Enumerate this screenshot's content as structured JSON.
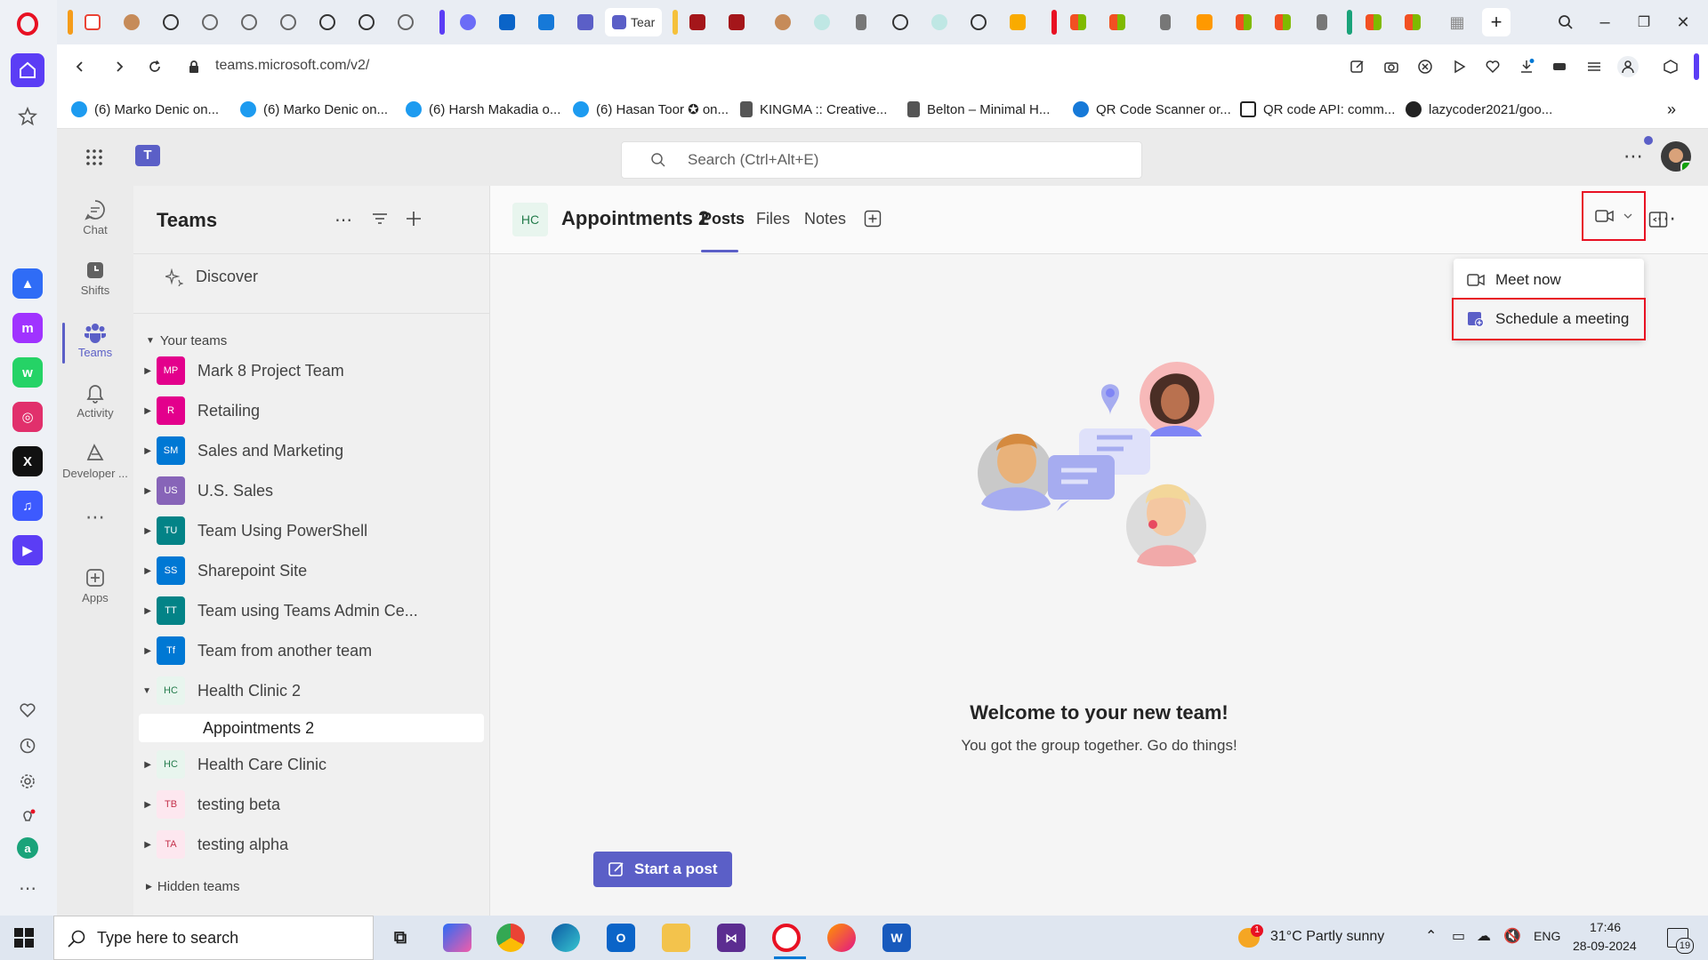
{
  "browser": {
    "url": "teams.microsoft.com/v2/",
    "active_tab_title": "Tear",
    "bookmarks": [
      "(6) Marko Denic on...",
      "(6) Marko Denic on...",
      "(6) Harsh Makadia o...",
      "(6) Hasan Toor ✪ on...",
      "KINGMA :: Creative...",
      "Belton – Minimal H...",
      "QR Code Scanner or...",
      "QR code API: comm...",
      "lazycoder2021/goo..."
    ]
  },
  "teams": {
    "search_placeholder": "Search (Ctrl+Alt+E)",
    "rail": [
      {
        "label": "Chat",
        "icon": "chat-icon"
      },
      {
        "label": "Shifts",
        "icon": "shifts-icon"
      },
      {
        "label": "Teams",
        "icon": "teams-icon"
      },
      {
        "label": "Activity",
        "icon": "bell-icon"
      },
      {
        "label": "Developer ...",
        "icon": "developer-icon"
      },
      {
        "label": "Apps",
        "icon": "apps-plus-icon"
      }
    ],
    "list": {
      "title": "Teams",
      "discover": "Discover",
      "your_teams": "Your teams",
      "hidden_teams": "Hidden teams",
      "teams": [
        {
          "initials": "MP",
          "name": "Mark 8 Project Team",
          "color": "#e3008c",
          "text": "#ffffff"
        },
        {
          "initials": "R",
          "name": "Retailing",
          "color": "#e3008c",
          "text": "#ffffff"
        },
        {
          "initials": "SM",
          "name": "Sales and Marketing",
          "color": "#0078d4",
          "text": "#ffffff"
        },
        {
          "initials": "US",
          "name": "U.S. Sales",
          "color": "#8764b8",
          "text": "#ffffff"
        },
        {
          "initials": "TU",
          "name": "Team Using PowerShell",
          "color": "#038387",
          "text": "#ffffff"
        },
        {
          "initials": "SS",
          "name": "Sharepoint Site",
          "color": "#0078d4",
          "text": "#ffffff"
        },
        {
          "initials": "TT",
          "name": "Team using Teams Admin Ce...",
          "color": "#038387",
          "text": "#ffffff"
        },
        {
          "initials": "Tf",
          "name": "Team from another team",
          "color": "#0078d4",
          "text": "#ffffff"
        },
        {
          "initials": "HC",
          "name": "Health Clinic 2",
          "color": "#e8f5ee",
          "text": "#237b4b"
        },
        {
          "initials": "HC",
          "name": "Health Care Clinic",
          "color": "#e8f5ee",
          "text": "#237b4b"
        },
        {
          "initials": "TB",
          "name": "testing beta",
          "color": "#fde7ef",
          "text": "#c4314b"
        },
        {
          "initials": "TA",
          "name": "testing alpha",
          "color": "#fde7ef",
          "text": "#c4314b"
        }
      ],
      "channel": "Appointments 2"
    },
    "channel": {
      "avatar": "HC",
      "name": "Appointments 2",
      "tabs": [
        "Posts",
        "Files",
        "Notes"
      ],
      "active_tab": "Posts",
      "meet_menu": {
        "meet_now": "Meet now",
        "schedule": "Schedule a meeting"
      },
      "welcome_title": "Welcome to your new team!",
      "welcome_sub": "You got the group together. Go do things!",
      "start_post": "Start a post"
    }
  },
  "taskbar": {
    "search_placeholder": "Type here to search",
    "weather": "31°C  Partly sunny",
    "weather_badge": "1",
    "language": "ENG",
    "time": "17:46",
    "date": "28-09-2024",
    "notifications": "19"
  },
  "colors": {
    "teams_accent": "#5b5fc7",
    "highlight_red": "#e81123"
  }
}
